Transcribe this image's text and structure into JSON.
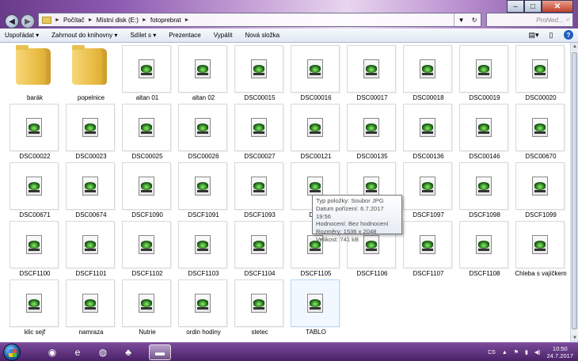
{
  "window": {
    "controls": {
      "minimize": "–",
      "maximize": "□",
      "close": "✕"
    }
  },
  "address": {
    "crumbs": [
      "Počítač",
      "Místní disk (E:)",
      "fotoprebrat"
    ],
    "search_placeholder": "Prohled..."
  },
  "toolbar": {
    "items": [
      "Uspořádat ▾",
      "Zahrnout do knihovny ▾",
      "Sdílet s ▾",
      "Prezentace",
      "Vypálit",
      "Nová složka"
    ]
  },
  "files": [
    {
      "name": "barák",
      "type": "folder"
    },
    {
      "name": "popelnice",
      "type": "folder"
    },
    {
      "name": "altan 01",
      "type": "jpg"
    },
    {
      "name": "altan 02",
      "type": "jpg"
    },
    {
      "name": "DSC00015",
      "type": "jpg"
    },
    {
      "name": "DSC00016",
      "type": "jpg"
    },
    {
      "name": "DSC00017",
      "type": "jpg"
    },
    {
      "name": "DSC00018",
      "type": "jpg"
    },
    {
      "name": "DSC00019",
      "type": "jpg"
    },
    {
      "name": "DSC00020",
      "type": "jpg"
    },
    {
      "name": "DSC00022",
      "type": "jpg"
    },
    {
      "name": "DSC00023",
      "type": "jpg"
    },
    {
      "name": "DSC00025",
      "type": "jpg"
    },
    {
      "name": "DSC00026",
      "type": "jpg"
    },
    {
      "name": "DSC00027",
      "type": "jpg"
    },
    {
      "name": "DSC00121",
      "type": "jpg"
    },
    {
      "name": "DSC00135",
      "type": "jpg"
    },
    {
      "name": "DSC00136",
      "type": "jpg"
    },
    {
      "name": "DSC00146",
      "type": "jpg"
    },
    {
      "name": "DSC00670",
      "type": "jpg"
    },
    {
      "name": "DSC00671",
      "type": "jpg"
    },
    {
      "name": "DSC00674",
      "type": "jpg"
    },
    {
      "name": "DSCF1090",
      "type": "jpg"
    },
    {
      "name": "DSCF1091",
      "type": "jpg"
    },
    {
      "name": "DSCF1093",
      "type": "jpg"
    },
    {
      "name": "DSC",
      "type": "jpg"
    },
    {
      "name": "",
      "type": "jpg"
    },
    {
      "name": "DSCF1097",
      "type": "jpg"
    },
    {
      "name": "DSCF1098",
      "type": "jpg"
    },
    {
      "name": "DSCF1099",
      "type": "jpg"
    },
    {
      "name": "DSCF1100",
      "type": "jpg"
    },
    {
      "name": "DSCF1101",
      "type": "jpg"
    },
    {
      "name": "DSCF1102",
      "type": "jpg"
    },
    {
      "name": "DSCF1103",
      "type": "jpg"
    },
    {
      "name": "DSCF1104",
      "type": "jpg"
    },
    {
      "name": "DSCF1105",
      "type": "jpg"
    },
    {
      "name": "DSCF1106",
      "type": "jpg"
    },
    {
      "name": "DSCF1107",
      "type": "jpg"
    },
    {
      "name": "DSCF1108",
      "type": "jpg"
    },
    {
      "name": "Chleba s vajíčkem",
      "type": "jpg"
    },
    {
      "name": "klic sejf",
      "type": "jpg"
    },
    {
      "name": "namraza",
      "type": "jpg"
    },
    {
      "name": "Nutrie",
      "type": "jpg"
    },
    {
      "name": "ordin hodiny",
      "type": "jpg"
    },
    {
      "name": "stetec",
      "type": "jpg"
    },
    {
      "name": "TABLO",
      "type": "jpg",
      "selected": true
    }
  ],
  "tooltip": {
    "line1": "Typ položky: Soubor JPG",
    "line2": "Datum pořízení: 6.7.2017 19:56",
    "line3": "Hodnocení: Bez hodnocení",
    "line4": "Rozměry: 1536 x 2048",
    "line5": "Velikost: 741 kB"
  },
  "taskbar": {
    "tray_lang": "CS",
    "time": "10:50",
    "date": "24.7.2017",
    "apps": [
      {
        "name": "media-player-icon",
        "glyph": "◉"
      },
      {
        "name": "internet-explorer-icon",
        "glyph": "e"
      },
      {
        "name": "firefox-icon",
        "glyph": "◍"
      },
      {
        "name": "game-icon",
        "glyph": "♣"
      },
      {
        "name": "explorer-icon",
        "glyph": "▬"
      }
    ]
  }
}
